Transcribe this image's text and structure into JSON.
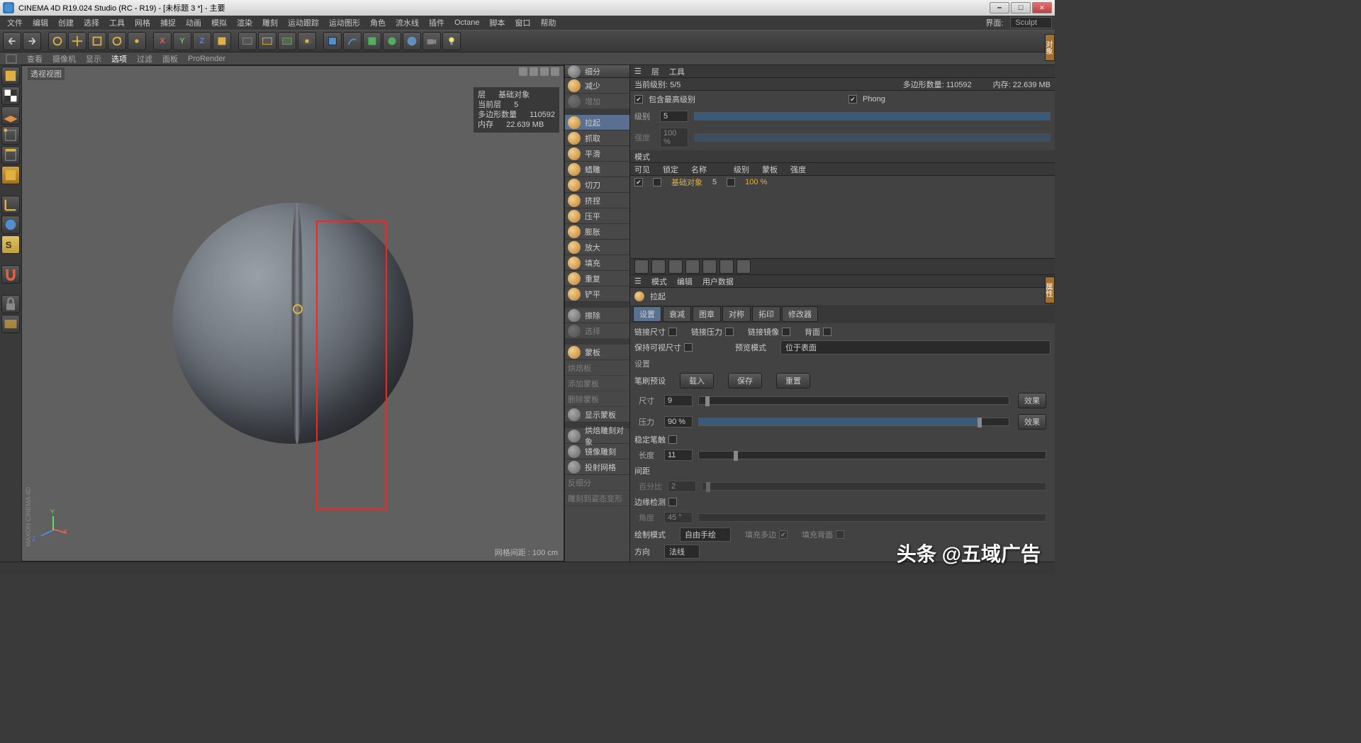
{
  "window": {
    "title": "CINEMA 4D R19.024 Studio (RC - R19) - [未标题 3 *] - 主要",
    "min": "━",
    "max": "☐",
    "close": "✕"
  },
  "menu": {
    "items": [
      "文件",
      "编辑",
      "创建",
      "选择",
      "工具",
      "网格",
      "捕捉",
      "动画",
      "模拟",
      "渲染",
      "雕刻",
      "运动跟踪",
      "运动图形",
      "角色",
      "流水线",
      "插件",
      "Octane",
      "脚本",
      "窗口",
      "帮助"
    ],
    "layout_label": "界面:",
    "layout_value": "Sculpt"
  },
  "subbar": {
    "items": [
      "查看",
      "摄像机",
      "显示",
      "选项",
      "过滤",
      "面板",
      "ProRender"
    ]
  },
  "viewport": {
    "label": "透视视图",
    "info": {
      "layer_label": "层",
      "layer_value": "基础对象",
      "curlayer_label": "当前层",
      "curlayer_value": "5",
      "poly_label": "多边形数量",
      "poly_value": "110592",
      "mem_label": "内存",
      "mem_value": "22.639 MB"
    },
    "grid_label": "网格间距 : 100 cm",
    "axes": {
      "x": "X",
      "y": "Y",
      "z": "Z"
    }
  },
  "sculpt_tools": {
    "header": "细分",
    "items": [
      "减少",
      "增加",
      "拉起",
      "抓取",
      "平滑",
      "蜡雕",
      "切刀",
      "挤捏",
      "压平",
      "膨胀",
      "放大",
      "填充",
      "重复",
      "铲平"
    ],
    "erase": "擦除",
    "select": "选择",
    "mask_items": [
      "蒙板",
      "烘焙板",
      "添加蒙板",
      "删除蒙板",
      "显示蒙板"
    ],
    "bake_items": [
      "烘焙雕刻对象",
      "镜像雕刻",
      "投射网格",
      "反细分",
      "雕刻到姿态变形"
    ]
  },
  "right_panel": {
    "tabs_top": [
      "层",
      "工具"
    ],
    "status": {
      "cur_level_label": "当前级别:",
      "cur_level": "5/5",
      "poly_label": "多边形数量:",
      "poly": "110592",
      "mem_label": "内存:",
      "mem": "22.639 MB"
    },
    "include_label": "包含最高级别",
    "phong_label": "Phong",
    "level_label": "级别",
    "level_value": "5",
    "strength_label": "强度",
    "strength_value": "100 %",
    "mode_label": "模式",
    "table_headers": [
      "可见",
      "锁定",
      "名称",
      "级别",
      "蒙板",
      "强度"
    ],
    "table_row": {
      "name": "基础对象",
      "level": "5",
      "strength": "100 %"
    },
    "attr_bar": [
      "模式",
      "编辑",
      "用户数据"
    ],
    "attr_title": "拉起",
    "attr_tabs": [
      "设置",
      "衰减",
      "图章",
      "对称",
      "拓印",
      "修改器"
    ],
    "link_opts": {
      "size": "链接尺寸",
      "pressure": "链接压力",
      "mirror": "链接镜像",
      "back": "背面"
    },
    "keep_visual": "保持可视尺寸",
    "preview_mode_label": "预览模式",
    "preview_mode_value": "位于表面",
    "settings_label": "设置",
    "brush_preset_label": "笔刷预设",
    "brush_btns": [
      "载入",
      "保存",
      "重置"
    ],
    "size_label": "尺寸",
    "size_value": "9",
    "pressure_label": "压力",
    "pressure_value": "90 %",
    "effect_btn": "效果",
    "steady_label": "稳定笔触",
    "length_label": "长度",
    "length_value": "11",
    "spacing_label": "间距",
    "percent_label": "百分比",
    "percent_value": "2",
    "edge_detect_label": "边缘检测",
    "angle_label": "角度",
    "angle_value": "45 °",
    "draw_mode_label": "绘制模式",
    "draw_mode_value": "自由手绘",
    "fill_poly_label": "填充多边",
    "fill_back_label": "填充背面",
    "direction_label": "方向",
    "direction_value": "法线"
  },
  "side_tabs": {
    "obj": "对象",
    "attr": "属性"
  },
  "watermark": "头条 @五域广告",
  "maxon": "MAXON CINEMA 4D"
}
